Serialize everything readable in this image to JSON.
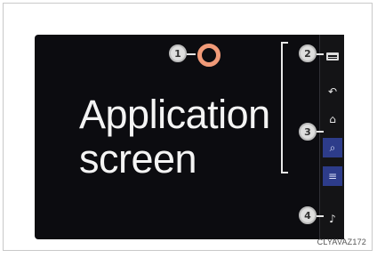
{
  "screen": {
    "app_label_line1": "Application",
    "app_label_line2": "screen"
  },
  "side_panel": {
    "items": [
      {
        "icon": "menu-icon"
      },
      {
        "icon": "back-icon",
        "glyph": "↶"
      },
      {
        "icon": "home-icon",
        "glyph": "⌂"
      },
      {
        "icon": "search-icon",
        "glyph": "⌕"
      },
      {
        "icon": "list-icon",
        "glyph": "≡"
      },
      {
        "icon": "music-note-icon",
        "glyph": "♪"
      }
    ]
  },
  "callouts": [
    "1",
    "2",
    "3",
    "4"
  ],
  "figure_code": "CLYAVAZ172",
  "colors": {
    "screen_bg": "#0c0c10",
    "ring": "#f09a78",
    "active_button": "#2d3c8a",
    "callout_fill": "#dedede"
  }
}
